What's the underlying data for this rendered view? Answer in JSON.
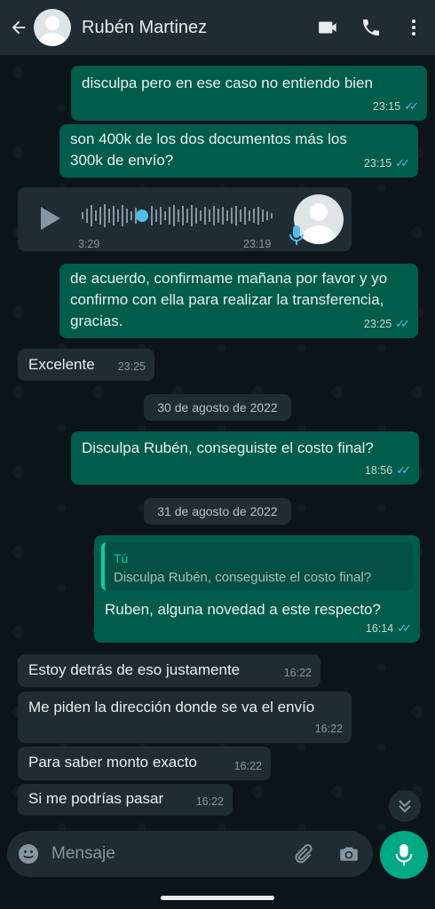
{
  "header": {
    "contact_name": "Rubén Martinez",
    "icons": [
      "back-arrow-icon",
      "contact-avatar",
      "video-call-icon",
      "phone-icon",
      "more-vert-icon"
    ]
  },
  "messages": [
    {
      "dir": "out",
      "text": "disculpa pero en ese caso no entiendo bien",
      "time": "23:15",
      "read": true
    },
    {
      "dir": "out",
      "text": "son 400k de los dos documentos más los 300k de envío?",
      "time": "23:15",
      "read": true
    },
    {
      "dir": "in",
      "type": "voice",
      "duration": "3:29",
      "time": "23:19"
    },
    {
      "dir": "out",
      "text": "de acuerdo, confirmame mañana por favor y yo confirmo con ella para realizar la transferencia, gracias.",
      "time": "23:25",
      "read": true
    },
    {
      "dir": "in",
      "text": "Excelente",
      "time": "23:25"
    },
    {
      "type": "date",
      "text": "30 de agosto de 2022"
    },
    {
      "dir": "out",
      "text": "Disculpa Rubén, conseguiste el costo final?",
      "time": "18:56",
      "read": true
    },
    {
      "type": "date",
      "text": "31 de agosto de 2022"
    },
    {
      "dir": "out",
      "quote_author": "Tú",
      "quote_text": "Disculpa Rubén, conseguiste el costo final?",
      "text": "Ruben, alguna novedad a este respecto?",
      "time": "16:14",
      "read": true
    },
    {
      "dir": "in",
      "text": "Estoy detrás de eso justamente",
      "time": "16:22"
    },
    {
      "dir": "in",
      "text": "Me piden la dirección donde se va el envío",
      "time": "16:22"
    },
    {
      "dir": "in",
      "text": "Para saber monto exacto",
      "time": "16:22"
    },
    {
      "dir": "in",
      "text": "Si me podrías pasar",
      "time": "16:22"
    }
  ],
  "composer": {
    "placeholder": "Mensaje",
    "icons": [
      "emoji-icon",
      "attach-icon",
      "camera-icon",
      "mic-icon"
    ]
  },
  "colors": {
    "background": "#0b141a",
    "outgoing_bubble": "#005c4b",
    "incoming_bubble": "#1f2c34",
    "accent": "#00a884",
    "read_ticks": "#53bdeb"
  }
}
